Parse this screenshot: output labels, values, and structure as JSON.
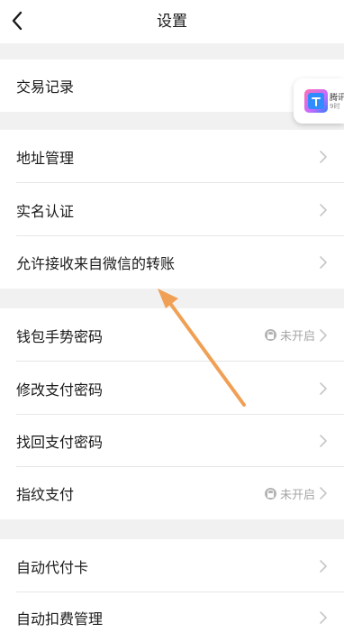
{
  "header": {
    "title": "设置",
    "back_icon": "chevron-left-icon"
  },
  "sections": [
    {
      "items": [
        {
          "label": "交易记录",
          "chevron": false
        }
      ]
    },
    {
      "items": [
        {
          "label": "地址管理",
          "chevron": true
        },
        {
          "label": "实名认证",
          "chevron": true
        },
        {
          "label": "允许接收来自微信的转账",
          "chevron": true
        }
      ]
    },
    {
      "items": [
        {
          "label": "钱包手势密码",
          "status": "未开启",
          "status_icon": "lock-icon",
          "chevron": true
        },
        {
          "label": "修改支付密码",
          "chevron": true
        },
        {
          "label": "找回支付密码",
          "chevron": true
        },
        {
          "label": "指纹支付",
          "status": "未开启",
          "status_icon": "lock-icon",
          "chevron": true
        }
      ]
    },
    {
      "items": [
        {
          "label": "自动代付卡",
          "chevron": true
        },
        {
          "label": "自动扣费管理",
          "chevron": true
        }
      ]
    }
  ],
  "floating_ad": {
    "title": "腾讯",
    "subtitle": "9时"
  },
  "annotation": {
    "icon": "orange-arrow",
    "color": "#f0a055"
  },
  "colors": {
    "background": "#f1f1f1",
    "row": "#ffffff",
    "chevron": "#c7c7c7",
    "status_text": "#a6a6a6"
  }
}
